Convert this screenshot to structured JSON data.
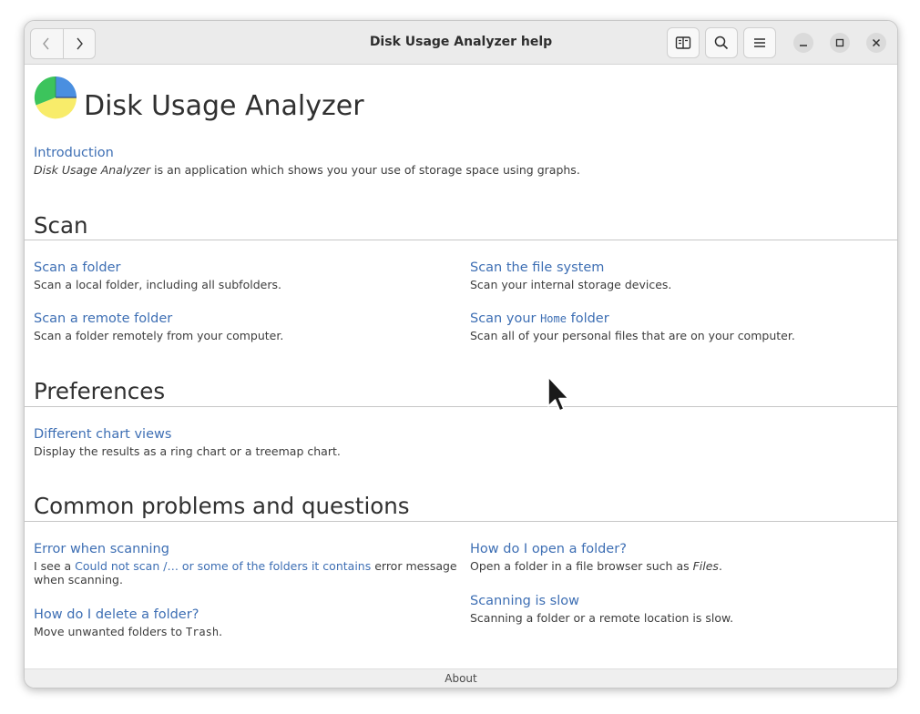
{
  "window": {
    "title": "Disk Usage Analyzer help"
  },
  "header_icons": [
    "back-icon",
    "forward-icon",
    "bookmarks-icon",
    "search-icon",
    "menu-icon",
    "minimize-icon",
    "maximize-icon",
    "close-icon"
  ],
  "page": {
    "title": "Disk Usage Analyzer",
    "intro": {
      "link": "Introduction",
      "desc_em": "Disk Usage Analyzer",
      "desc_rest": " is an application which shows you your use of storage space using graphs."
    }
  },
  "sections": {
    "scan": {
      "title": "Scan",
      "items": [
        {
          "link": "Scan a folder",
          "desc": "Scan a local folder, including all subfolders."
        },
        {
          "link": "Scan a remote folder",
          "desc": "Scan a folder remotely from your computer."
        },
        {
          "link": "Scan the file system",
          "desc": "Scan your internal storage devices."
        },
        {
          "link_pre": "Scan your ",
          "link_code": "Home",
          "link_post": " folder",
          "desc": "Scan all of your personal files that are on your computer."
        }
      ]
    },
    "preferences": {
      "title": "Preferences",
      "items": [
        {
          "link": "Different chart views",
          "desc": "Display the results as a ring chart or a treemap chart."
        }
      ]
    },
    "common": {
      "title": "Common problems and questions",
      "items": [
        {
          "link": "Error when scanning",
          "desc_pre": "I see a ",
          "desc_link": "Could not scan /… or some of the folders it contains",
          "desc_post1": " error message",
          "desc_post2": "when scanning."
        },
        {
          "link": "How do I delete a folder?",
          "desc_pre": "Move unwanted folders to ",
          "desc_code": "Trash",
          "desc_post": "."
        },
        {
          "link": "How do I open a folder?",
          "desc_pre": "Open a folder in a file browser such as ",
          "desc_em": "Files",
          "desc_post": "."
        },
        {
          "link": "Scanning is slow",
          "desc": "Scanning a folder or a remote location is slow."
        }
      ]
    }
  },
  "footer": {
    "about": "About"
  },
  "colors": {
    "link": "#3e6fb4",
    "titlebar": "#ebebeb",
    "logo_green": "#3cc45c",
    "logo_blue": "#4a8fe0",
    "logo_yellow": "#f8ec6a"
  }
}
